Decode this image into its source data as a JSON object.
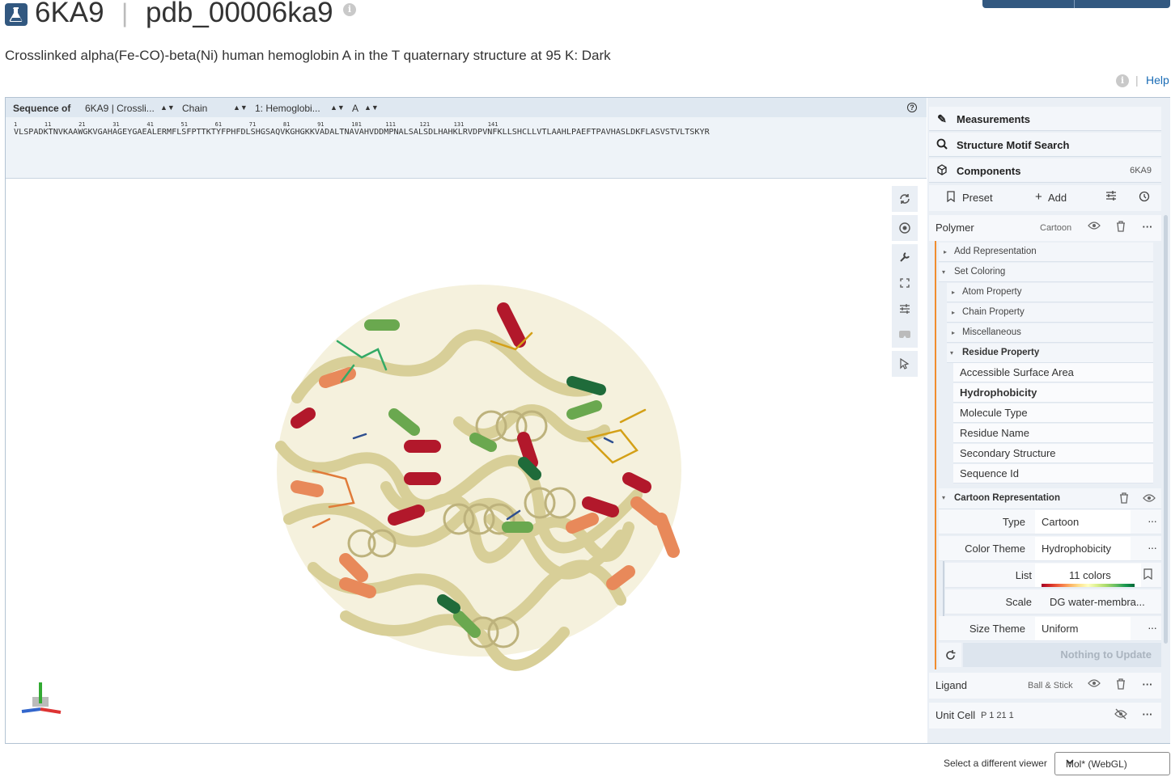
{
  "header": {
    "entry_id": "6KA9",
    "separator": "|",
    "pdb_id": "pdb_00006ka9",
    "info_glyph": "i",
    "subtitle": "Crosslinked alpha(Fe-CO)-beta(Ni) human hemoglobin A in the T quaternary structure at 95 K: Dark",
    "help_sep": "|",
    "help_label": "Help"
  },
  "sequence": {
    "label": "Sequence of",
    "entity_select": "6KA9 | Crossli...",
    "chain_mode_select": "Chain",
    "chain_select": "1: Hemoglobi...",
    "instance_select": "A",
    "help_glyph": "?",
    "numbers": "1        11        21        31        41        51        61        71        81        91        101       111       121       131       141",
    "residues": "VLSPADKTNVKAAWGKVGAHAGEYGAEALERMFLSFPTTKTYFPHFDLSHGSAQVKGHGKKVADALTNAVAHVDDMPNALSALSDLHAHKLRVDPVNFKLLSHCLLVTLAAHLPAEFTPAVHASLDKFLASVSTVLTSKYR"
  },
  "viewport_controls": [
    {
      "name": "reset-camera-icon",
      "glyph": "⟳"
    },
    {
      "name": "screenshot-icon",
      "glyph": "◉"
    },
    {
      "name": "wrench-icon",
      "glyph": "🔧"
    },
    {
      "name": "fullscreen-icon",
      "glyph": "⛶"
    },
    {
      "name": "settings-icon",
      "glyph": "☰"
    },
    {
      "name": "vr-icon",
      "glyph": "▭"
    },
    {
      "name": "select-mode-icon",
      "glyph": "➚"
    }
  ],
  "right_panel": {
    "measurements": "Measurements",
    "motif_search": "Structure Motif Search",
    "components": "Components",
    "components_id": "6KA9",
    "preset": "Preset",
    "add": "Add",
    "polymer": {
      "name": "Polymer",
      "repr": "Cartoon"
    },
    "add_representation": "Add Representation",
    "set_coloring": "Set Coloring",
    "coloring_groups": [
      "Atom Property",
      "Chain Property",
      "Miscellaneous",
      "Residue Property"
    ],
    "residue_property_options": [
      "Accessible Surface Area",
      "Hydrophobicity",
      "Molecule Type",
      "Residue Name",
      "Secondary Structure",
      "Sequence Id"
    ],
    "cartoon_representation": "Cartoon Representation",
    "fields": {
      "type_label": "Type",
      "type_value": "Cartoon",
      "color_theme_label": "Color Theme",
      "color_theme_value": "Hydrophobicity",
      "list_label": "List",
      "list_value": "11 colors",
      "scale_label": "Scale",
      "scale_value": "DG water-membra...",
      "size_theme_label": "Size Theme",
      "size_theme_value": "Uniform"
    },
    "nothing_to_update": "Nothing to Update",
    "ligand": {
      "name": "Ligand",
      "repr": "Ball & Stick"
    },
    "unit_cell": {
      "name": "Unit Cell",
      "space_group": "P 1 21 1"
    }
  },
  "footer": {
    "viewer_label": "Select a different viewer",
    "viewer_value": "Mol* (WebGL)"
  },
  "colors": {
    "brand": "#325880",
    "accent_orange": "#f08c2e",
    "link": "#1a6cb5",
    "panel_bg": "#eaeff5"
  }
}
